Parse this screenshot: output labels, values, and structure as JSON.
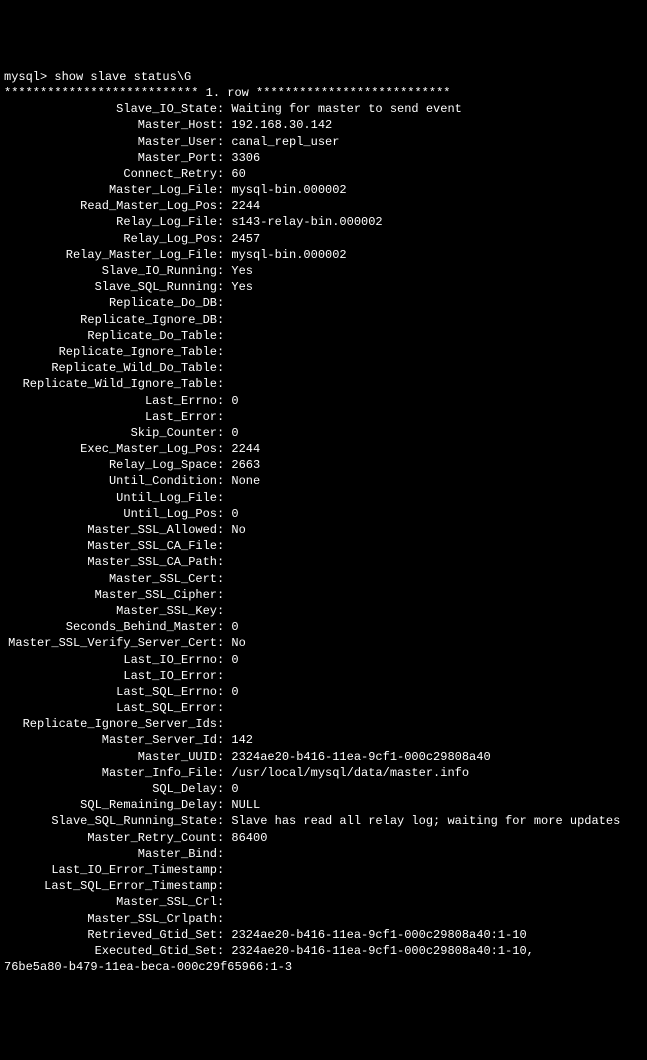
{
  "prompt": "mysql> show slave status\\G",
  "separator": "*************************** 1. row ***************************",
  "fields": [
    {
      "label": "Slave_IO_State",
      "value": "Waiting for master to send event"
    },
    {
      "label": "Master_Host",
      "value": "192.168.30.142"
    },
    {
      "label": "Master_User",
      "value": "canal_repl_user"
    },
    {
      "label": "Master_Port",
      "value": "3306"
    },
    {
      "label": "Connect_Retry",
      "value": "60"
    },
    {
      "label": "Master_Log_File",
      "value": "mysql-bin.000002"
    },
    {
      "label": "Read_Master_Log_Pos",
      "value": "2244"
    },
    {
      "label": "Relay_Log_File",
      "value": "s143-relay-bin.000002"
    },
    {
      "label": "Relay_Log_Pos",
      "value": "2457"
    },
    {
      "label": "Relay_Master_Log_File",
      "value": "mysql-bin.000002"
    },
    {
      "label": "Slave_IO_Running",
      "value": "Yes"
    },
    {
      "label": "Slave_SQL_Running",
      "value": "Yes"
    },
    {
      "label": "Replicate_Do_DB",
      "value": ""
    },
    {
      "label": "Replicate_Ignore_DB",
      "value": ""
    },
    {
      "label": "Replicate_Do_Table",
      "value": ""
    },
    {
      "label": "Replicate_Ignore_Table",
      "value": ""
    },
    {
      "label": "Replicate_Wild_Do_Table",
      "value": ""
    },
    {
      "label": "Replicate_Wild_Ignore_Table",
      "value": ""
    },
    {
      "label": "Last_Errno",
      "value": "0"
    },
    {
      "label": "Last_Error",
      "value": ""
    },
    {
      "label": "Skip_Counter",
      "value": "0"
    },
    {
      "label": "Exec_Master_Log_Pos",
      "value": "2244"
    },
    {
      "label": "Relay_Log_Space",
      "value": "2663"
    },
    {
      "label": "Until_Condition",
      "value": "None"
    },
    {
      "label": "Until_Log_File",
      "value": ""
    },
    {
      "label": "Until_Log_Pos",
      "value": "0"
    },
    {
      "label": "Master_SSL_Allowed",
      "value": "No"
    },
    {
      "label": "Master_SSL_CA_File",
      "value": ""
    },
    {
      "label": "Master_SSL_CA_Path",
      "value": ""
    },
    {
      "label": "Master_SSL_Cert",
      "value": ""
    },
    {
      "label": "Master_SSL_Cipher",
      "value": ""
    },
    {
      "label": "Master_SSL_Key",
      "value": ""
    },
    {
      "label": "Seconds_Behind_Master",
      "value": "0"
    },
    {
      "label": "Master_SSL_Verify_Server_Cert",
      "value": "No"
    },
    {
      "label": "Last_IO_Errno",
      "value": "0"
    },
    {
      "label": "Last_IO_Error",
      "value": ""
    },
    {
      "label": "Last_SQL_Errno",
      "value": "0"
    },
    {
      "label": "Last_SQL_Error",
      "value": ""
    },
    {
      "label": "Replicate_Ignore_Server_Ids",
      "value": ""
    },
    {
      "label": "Master_Server_Id",
      "value": "142"
    },
    {
      "label": "Master_UUID",
      "value": "2324ae20-b416-11ea-9cf1-000c29808a40"
    },
    {
      "label": "Master_Info_File",
      "value": "/usr/local/mysql/data/master.info"
    },
    {
      "label": "SQL_Delay",
      "value": "0"
    },
    {
      "label": "SQL_Remaining_Delay",
      "value": "NULL"
    },
    {
      "label": "Slave_SQL_Running_State",
      "value": "Slave has read all relay log; waiting for more updates"
    },
    {
      "label": "Master_Retry_Count",
      "value": "86400"
    },
    {
      "label": "Master_Bind",
      "value": ""
    },
    {
      "label": "Last_IO_Error_Timestamp",
      "value": ""
    },
    {
      "label": "Last_SQL_Error_Timestamp",
      "value": ""
    },
    {
      "label": "Master_SSL_Crl",
      "value": ""
    },
    {
      "label": "Master_SSL_Crlpath",
      "value": ""
    },
    {
      "label": "Retrieved_Gtid_Set",
      "value": "2324ae20-b416-11ea-9cf1-000c29808a40:1-10"
    },
    {
      "label": "Executed_Gtid_Set",
      "value": "2324ae20-b416-11ea-9cf1-000c29808a40:1-10,"
    }
  ],
  "trailing": "76be5a80-b479-11ea-beca-000c29f65966:1-3"
}
